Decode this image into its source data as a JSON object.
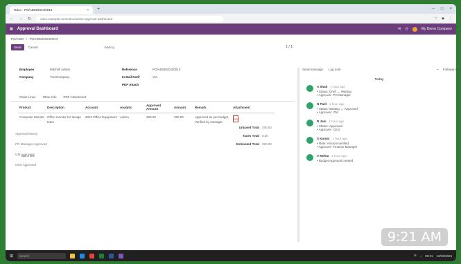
{
  "browser": {
    "tab_title": "Odoo - PO/ADM/2024/0013",
    "url": "odoo.example.com/odoo/action-approval-dashboard",
    "plus": "+",
    "minimize": "–",
    "maximize": "□",
    "close": "×"
  },
  "app": {
    "title": "Approval Dashboard",
    "company": "My Demo Company"
  },
  "breadcrumb": [
    "PO/ADM",
    "PO/ADM/2024/0013"
  ],
  "toolbar": {
    "confirm": "Send",
    "cancel": "Cancel",
    "status": "Waiting",
    "pager": "1 / 1"
  },
  "fields": [
    {
      "label": "Employee",
      "value": "Mitchell Admin"
    },
    {
      "label": "Reference",
      "value": "PO/ADM/2024/0013"
    },
    {
      "label": "Company",
      "value": "YourCompany"
    },
    {
      "label": "In Mail Notif",
      "value": "Yes"
    },
    {
      "label": "PDF Attach",
      "value": ""
    }
  ],
  "tabs": [
    "Order Lines",
    "Other Info",
    "PDF Attachment"
  ],
  "table": {
    "headers": [
      "Product",
      "Description",
      "Account",
      "Analytic",
      "Approved Amount",
      "Amount",
      "Remark",
      "Attachment"
    ],
    "rows": [
      [
        "Computer Monitor",
        "Office monitor for design team",
        "6012 Office Equipment",
        "Admin",
        "250.00",
        "250.00",
        "Approved as per budget. Verified by manager.",
        "PDF"
      ]
    ]
  },
  "add_line": "Add a line",
  "totals": [
    {
      "label": "Untaxed Total",
      "value": "250.00"
    },
    {
      "label": "Taxes Total",
      "value": "0.00"
    },
    {
      "label": "Estimated Total",
      "value": "250.00"
    }
  ],
  "notes": [
    "Approval history",
    "PO Manager Approved",
    "GM Approved",
    "CEO Approved"
  ],
  "chatter": {
    "send": "Send message",
    "log": "Log note",
    "followers": "Followers",
    "today": "Today",
    "messages": [
      {
        "author": "A Shah",
        "time": "1 hour ago",
        "lines": [
          "Status: Draft → Waiting",
          "Approver: PO Manager"
        ]
      },
      {
        "author": "N Patil",
        "time": "1 hour ago",
        "lines": [
          "Status: Waiting → Approved",
          "Approver: GM"
        ]
      },
      {
        "author": "R Jain",
        "time": "1 hour ago",
        "lines": [
          "Status: Approved",
          "Approver: CEO"
        ]
      },
      {
        "author": "S Kumar",
        "time": "1 hour ago",
        "lines": [
          "Note: Amount verified",
          "Approver: Finance Manager"
        ]
      },
      {
        "author": "V Mehta",
        "time": "1 hour ago",
        "lines": [
          "Budget Approval created"
        ]
      }
    ]
  },
  "clock": "9:21 AM",
  "taskbar": {
    "search": "Search",
    "tray_time": "09:21",
    "tray_date": "12/03/2024"
  },
  "colors": {
    "brand": "#6b3d7a",
    "chatter_avatar": "#2ea36a"
  }
}
